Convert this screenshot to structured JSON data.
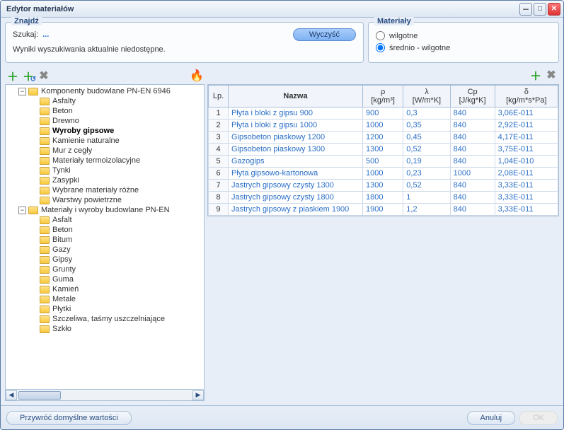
{
  "window": {
    "title": "Edytor materiałów"
  },
  "find": {
    "legend": "Znajdź",
    "label": "Szukaj:",
    "value": "...",
    "clear_btn": "Wyczyść",
    "message": "Wyniki wyszukiwania aktualnie niedostępne."
  },
  "materials": {
    "legend": "Materiały",
    "opt1": "wilgotne",
    "opt2": "średnio - wilgotne",
    "selected": "opt2"
  },
  "tree": {
    "root1": "Komponenty budowlane PN-EN 6946",
    "root1_items": [
      "Asfalty",
      "Beton",
      "Drewno",
      "Wyroby gipsowe",
      "Kamienie naturalne",
      "Mur z cegły",
      "Materiały termoizolacyjne",
      "Tynki",
      "Zasypki",
      "Wybrane materiały różne",
      "Warstwy powietrzne"
    ],
    "root1_selected_index": 3,
    "root2": "Materiały i wyroby budowlane PN-EN",
    "root2_items": [
      "Asfalt",
      "Beton",
      "Bitum",
      "Gazy",
      "Gipsy",
      "Grunty",
      "Guma",
      "Kamień",
      "Metale",
      "Płytki",
      "Szczeliwa, taśmy uszczelniające",
      "Szkło"
    ]
  },
  "grid": {
    "headers": {
      "lp": "Lp.",
      "nazwa": "Nazwa",
      "rho": "ρ",
      "rho_unit": "[kg/m³]",
      "lambda": "λ",
      "lambda_unit": "[W/m*K]",
      "cp": "Cp",
      "cp_unit": "[J/kg*K]",
      "delta": "δ",
      "delta_unit": "[kg/m*s*Pa]"
    },
    "rows": [
      {
        "lp": "1",
        "nazwa": "Płyta i bloki z gipsu 900",
        "rho": "900",
        "lambda": "0,3",
        "cp": "840",
        "delta": "3,06E-011"
      },
      {
        "lp": "2",
        "nazwa": "Płyta i bloki z gipsu 1000",
        "rho": "1000",
        "lambda": "0,35",
        "cp": "840",
        "delta": "2,92E-011"
      },
      {
        "lp": "3",
        "nazwa": "Gipsobeton piaskowy 1200",
        "rho": "1200",
        "lambda": "0,45",
        "cp": "840",
        "delta": "4,17E-011"
      },
      {
        "lp": "4",
        "nazwa": "Gipsobeton piaskowy 1300",
        "rho": "1300",
        "lambda": "0,52",
        "cp": "840",
        "delta": "3,75E-011"
      },
      {
        "lp": "5",
        "nazwa": "Gazogips",
        "rho": "500",
        "lambda": "0,19",
        "cp": "840",
        "delta": "1,04E-010"
      },
      {
        "lp": "6",
        "nazwa": "Płyta gipsowo-kartonowa",
        "rho": "1000",
        "lambda": "0,23",
        "cp": "1000",
        "delta": "2,08E-011"
      },
      {
        "lp": "7",
        "nazwa": "Jastrych gipsowy czysty 1300",
        "rho": "1300",
        "lambda": "0,52",
        "cp": "840",
        "delta": "3,33E-011"
      },
      {
        "lp": "8",
        "nazwa": "Jastrych gipsowy czysty 1800",
        "rho": "1800",
        "lambda": "1",
        "cp": "840",
        "delta": "3,33E-011"
      },
      {
        "lp": "9",
        "nazwa": "Jastrych gipsowy z piaskiem 1900",
        "rho": "1900",
        "lambda": "1,2",
        "cp": "840",
        "delta": "3,33E-011"
      }
    ]
  },
  "footer": {
    "restore": "Przywróć domyślne wartości",
    "cancel": "Anuluj",
    "ok": "OK"
  }
}
